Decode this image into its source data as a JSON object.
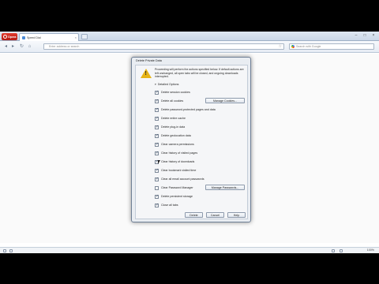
{
  "browser": {
    "menu_label": "Opera",
    "tab_label": "Speed Dial",
    "address_placeholder": "Enter address or search",
    "search_placeholder": "Search with Google"
  },
  "dialog": {
    "title": "Delete Private Data",
    "message": "Proceeding will perform the actions specified below. If default actions are left unchanged, all open tabs will be closed, and ongoing downloads interrupted.",
    "details_label": "Detailed Options",
    "options": [
      {
        "label": "Delete session cookies",
        "checked": true
      },
      {
        "label": "Delete all cookies",
        "checked": true
      },
      {
        "label": "Delete password-protected pages and data",
        "checked": true
      },
      {
        "label": "Delete entire cache",
        "checked": true
      },
      {
        "label": "Delete plug-in data",
        "checked": true
      },
      {
        "label": "Delete geolocation data",
        "checked": true
      },
      {
        "label": "Clear camera permissions",
        "checked": true
      },
      {
        "label": "Clear history of visited pages",
        "checked": true
      },
      {
        "label": "Clear history of downloads",
        "checked": true
      },
      {
        "label": "Clear bookmark visited time",
        "checked": true
      },
      {
        "label": "Clear all email account passwords",
        "checked": true
      },
      {
        "label": "Clear Password Manager",
        "checked": false
      },
      {
        "label": "Delete persistent storage",
        "checked": true
      },
      {
        "label": "Close all tabs",
        "checked": true
      }
    ],
    "manage_cookies_label": "Manage Cookies...",
    "manage_passwords_label": "Manage Passwords...",
    "delete_label": "Delete",
    "cancel_label": "Cancel",
    "help_label": "Help"
  },
  "status": {
    "zoom": "100%"
  }
}
